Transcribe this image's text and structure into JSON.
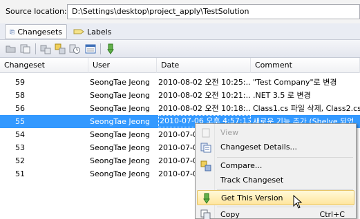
{
  "source": {
    "label": "Source location:",
    "path": "D:\\Settings\\desktop\\project_apply\\TestSolution"
  },
  "tabs": [
    {
      "label": "Changesets",
      "active": true
    },
    {
      "label": "Labels",
      "active": false
    }
  ],
  "grid": {
    "columns": [
      "Changeset",
      "User",
      "Date",
      "Comment"
    ],
    "rows": [
      {
        "changeset": "59",
        "user": "SeongTae Jeong",
        "date": "2010-08-02 오전 10:25:...",
        "comment": "\"Test Company\"로 변경"
      },
      {
        "changeset": "58",
        "user": "SeongTae Jeong",
        "date": "2010-08-02 오전 10:21:...",
        "comment": ".NET 3.5 로 변경"
      },
      {
        "changeset": "56",
        "user": "SeongTae Jeong",
        "date": "2010-08-02 오전 10:18:...",
        "comment": "Class1.cs 파일 삭제, Class2.cs"
      },
      {
        "changeset": "55",
        "user": "SeongTae Jeong",
        "date": "2010-07-06 오후 4:57:13",
        "comment": "새로운 기능 추가 (Shelve 되었",
        "selected": true
      },
      {
        "changeset": "54",
        "user": "SeongTae Jeong",
        "date": "2010-07-06",
        "comment": ""
      },
      {
        "changeset": "53",
        "user": "SeongTae Jeong",
        "date": "2010-07-06",
        "comment": ""
      },
      {
        "changeset": "52",
        "user": "SeongTae Jeong",
        "date": "2010-07-06",
        "comment": ""
      },
      {
        "changeset": "51",
        "user": "SeongTae Jeong",
        "date": "2010-07-06",
        "comment": ""
      }
    ]
  },
  "context_menu": {
    "view": "View",
    "details": "Changeset Details...",
    "compare": "Compare...",
    "track": "Track Changeset",
    "get_version": "Get This Version",
    "copy": "Copy",
    "copy_shortcut": "Ctrl+C"
  },
  "colors": {
    "selection": "#3399ff",
    "menu_hover": "#ffe69e"
  }
}
